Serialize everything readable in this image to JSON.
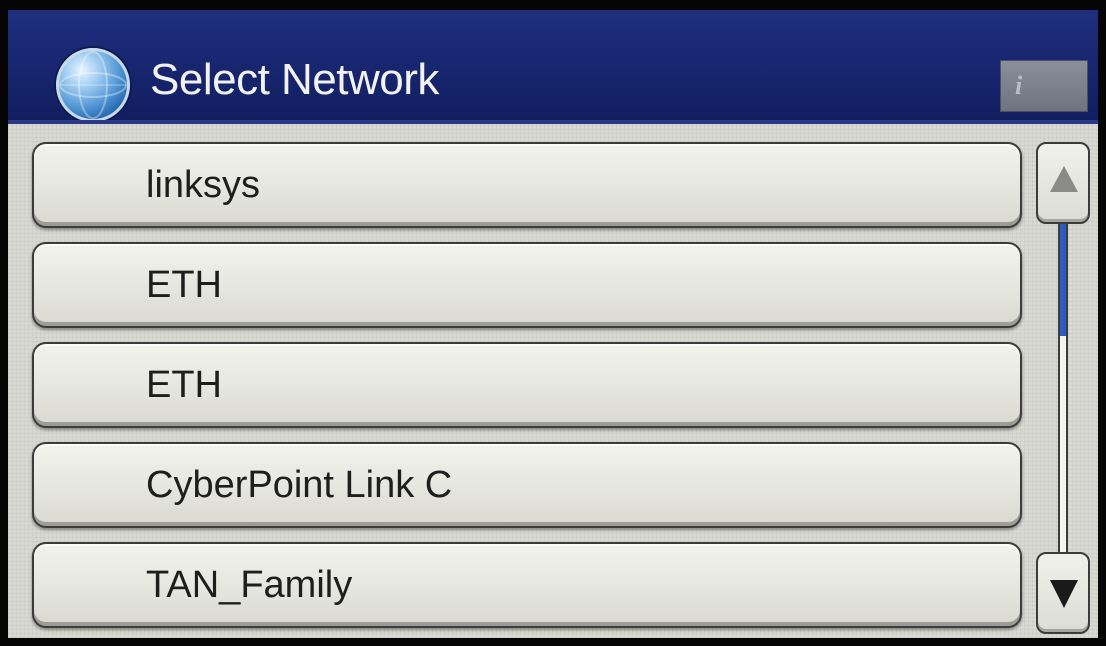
{
  "header": {
    "title": "Select Network",
    "globe_icon": "globe-icon",
    "info_label": "i"
  },
  "networks": [
    {
      "label": "linksys"
    },
    {
      "label": "ETH"
    },
    {
      "label": "ETH"
    },
    {
      "label": "CyberPoint Link C"
    },
    {
      "label": "TAN_Family"
    }
  ],
  "scrollbar": {
    "up_icon": "arrow-up-icon",
    "down_icon": "arrow-down-icon",
    "position_fraction": 0.0,
    "visible_fraction": 0.34
  },
  "colors": {
    "title_bar": "#17256e",
    "scroll_thumb": "#2f5bc0"
  }
}
